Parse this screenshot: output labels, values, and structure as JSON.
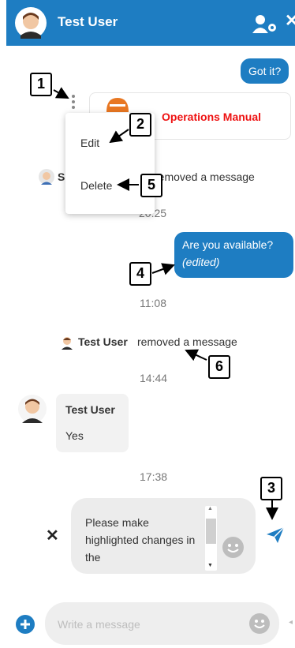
{
  "header": {
    "title": "Test User"
  },
  "messages": {
    "got_it": "Got it?",
    "file_name": "Operations Manual",
    "edited_text": "Are you available?",
    "edited_marker": "(edited)",
    "received_name": "Test User",
    "received_text": "Yes"
  },
  "context_menu": {
    "edit_label": "Edit",
    "delete_label": "Delete"
  },
  "system": {
    "partial_name": "S",
    "removed_text": "removed a message",
    "removed_name": "Test User"
  },
  "times": {
    "t1": "20:25",
    "t2": "11:08",
    "t3": "14:44",
    "t4": "17:38"
  },
  "edit_box": {
    "text": "Please make highlighted changes in the"
  },
  "compose": {
    "placeholder": "Write a message"
  },
  "callouts": {
    "c1": "1",
    "c2": "2",
    "c3": "3",
    "c4": "4",
    "c5": "5",
    "c6": "6"
  },
  "colors": {
    "brand": "#1e7dc2",
    "file_label": "#e11111",
    "bubble_grey": "#f2f2f2"
  }
}
